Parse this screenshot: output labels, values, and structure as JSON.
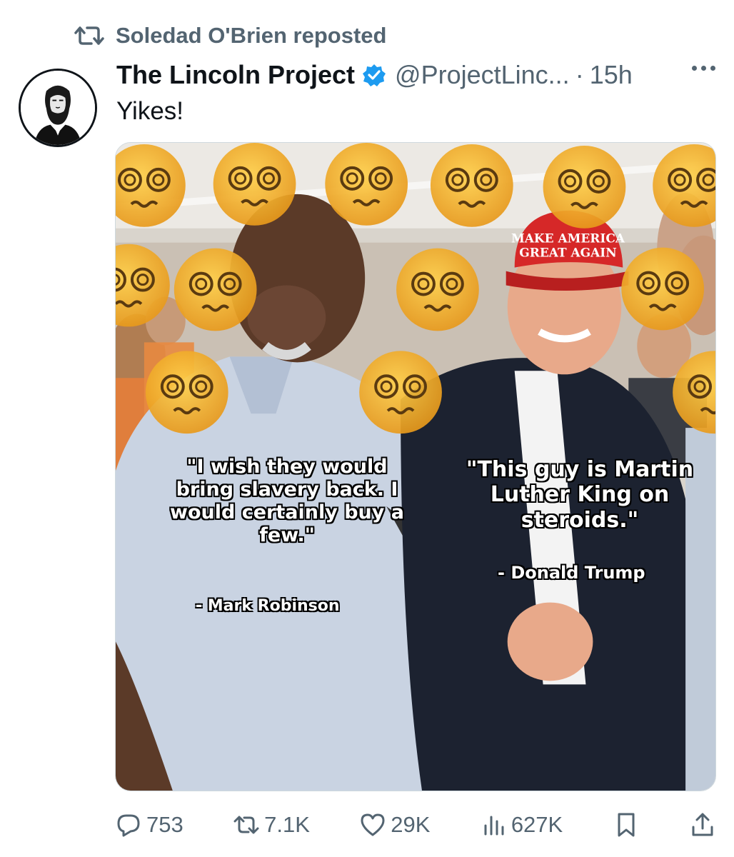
{
  "repost": {
    "text": "Soledad O'Brien reposted"
  },
  "tweet": {
    "author_name": "The Lincoln Project",
    "handle": "@ProjectLinc...",
    "separator": "·",
    "time": "15h",
    "text": "Yikes!"
  },
  "media": {
    "hat_text_line1": "MAKE AMERICA",
    "hat_text_line2": "GREAT AGAIN",
    "quote_left": "\"I wish they would bring slavery back. I would certainly buy a few.\"",
    "attribution_left": "- Mark Robinson",
    "quote_right": "\"This guy is Martin Luther King on steroids.\"",
    "attribution_right": "- Donald Trump"
  },
  "actions": {
    "replies": "753",
    "reposts": "7.1K",
    "likes": "29K",
    "views": "627K"
  },
  "icons": {
    "repost": "repost-icon",
    "avatar": "lincoln-portrait-icon",
    "verified": "verified-badge-icon",
    "more": "more-options-icon",
    "reply": "reply-icon",
    "like": "heart-icon",
    "views": "views-chart-icon",
    "bookmark": "bookmark-icon",
    "share": "share-icon"
  },
  "colors": {
    "secondary_text": "#536471",
    "verified_blue": "#1d9bf0",
    "hat_red": "#d62828"
  }
}
